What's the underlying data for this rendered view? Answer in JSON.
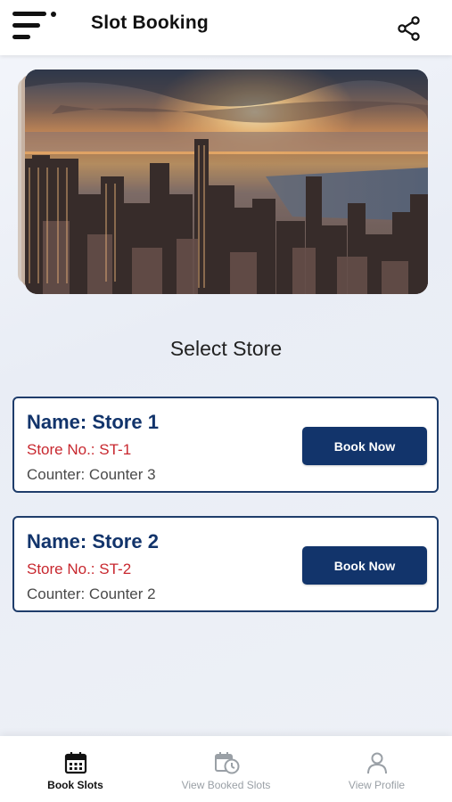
{
  "header": {
    "title": "Slot Booking",
    "menu_icon": "hamburger-menu-icon",
    "share_icon": "share-icon"
  },
  "banner": {
    "image": "city-skyline-sunset-image"
  },
  "section_title": "Select Store",
  "stores": [
    {
      "name": "Name: Store 1",
      "store_no": "Store No.: ST-1",
      "counter": "Counter: Counter 3",
      "button_label": "Book Now"
    },
    {
      "name": "Name: Store 2",
      "store_no": "Store No.: ST-2",
      "counter": "Counter: Counter 2",
      "button_label": "Book Now"
    }
  ],
  "bottom_nav": {
    "items": [
      {
        "label": "Book Slots",
        "icon": "calendar-icon",
        "active": true
      },
      {
        "label": "View Booked Slots",
        "icon": "calendar-clock-icon",
        "active": false
      },
      {
        "label": "View Profile",
        "icon": "person-icon",
        "active": false
      }
    ]
  },
  "colors": {
    "primary": "#12346b",
    "accent_red": "#c8282f",
    "inactive": "#9aa0a6"
  }
}
